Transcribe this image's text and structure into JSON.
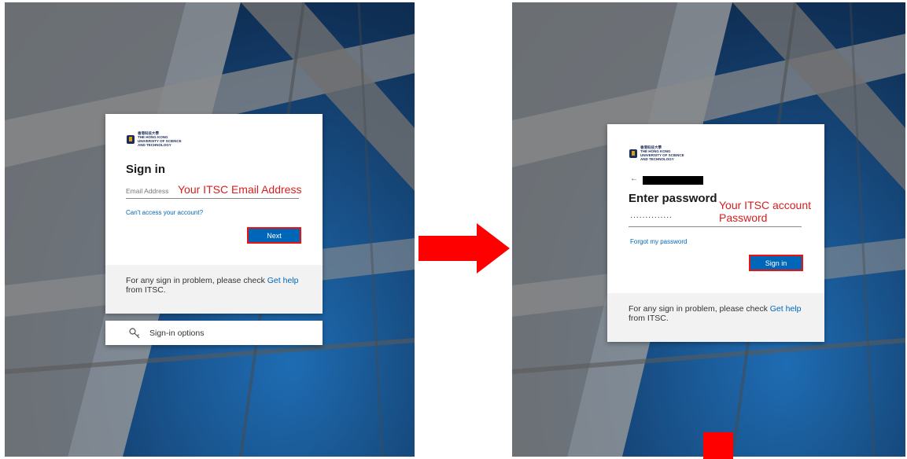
{
  "left": {
    "logo_text": "香港科技大學\nTHE HONG KONG\nUNIVERSITY OF SCIENCE\nAND TECHNOLOGY",
    "title": "Sign in",
    "email_placeholder": "Email Address",
    "annotation": "Your ITSC Email Address",
    "cant_access": "Can't access your account?",
    "next_label": "Next",
    "footer_prefix": "For any sign in problem, please check ",
    "footer_link": "Get help",
    "footer_suffix": " from ITSC.",
    "sign_in_options": "Sign-in options",
    "key_icon": "key-icon"
  },
  "right": {
    "logo_text": "香港科技大學\nTHE HONG KONG\nUNIVERSITY OF SCIENCE\nAND TECHNOLOGY",
    "back_arrow": "←",
    "title": "Enter password",
    "annotation_line1": "Your ITSC account",
    "annotation_line2": "Password",
    "password_dots": "··············",
    "forgot": "Forgot my password",
    "sign_in_label": "Sign in",
    "footer_prefix": "For any sign in problem, please check ",
    "footer_link": "Get help",
    "footer_suffix": " from ITSC."
  },
  "colors": {
    "accent": "#0067b8",
    "annotation": "#d31f1f",
    "arrow": "#ff0000"
  }
}
